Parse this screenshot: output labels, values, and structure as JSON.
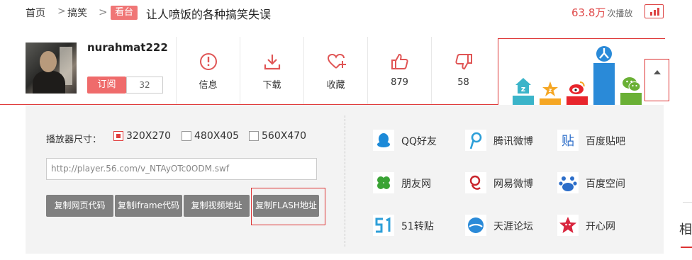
{
  "breadcrumb": {
    "home": "首页",
    "separator": ">",
    "category": "搞笑",
    "badge": "看台",
    "title": "让人喷饭的各种搞笑失误"
  },
  "plays": {
    "count": "63.8万",
    "label": "次播放"
  },
  "uploader": {
    "name": "nurahmat222",
    "subscribe_label": "订阅",
    "subscriber_count": "32"
  },
  "actions": [
    {
      "label": "信息",
      "icon": "info-icon"
    },
    {
      "label": "下载",
      "icon": "download-icon"
    },
    {
      "label": "收藏",
      "icon": "favorite-icon"
    },
    {
      "label": "879",
      "icon": "thumbs-up-icon"
    },
    {
      "label": "58",
      "icon": "thumbs-down-icon"
    }
  ],
  "embed": {
    "size_label": "播放器尺寸：",
    "sizes": [
      {
        "label": "320X270",
        "selected": true
      },
      {
        "label": "480X405",
        "selected": false
      },
      {
        "label": "560X470",
        "selected": false
      }
    ],
    "url": "http://player.56.com/v_NTAyOTc0ODM.swf",
    "buttons": [
      "复制网页代码",
      "复制iframe代码",
      "复制视频地址",
      "复制FLASH地址"
    ]
  },
  "share_sites": [
    {
      "name": "QQ好友",
      "icon": "qq-icon"
    },
    {
      "name": "腾讯微博",
      "icon": "tencent-weibo-icon"
    },
    {
      "name": "百度贴吧",
      "icon": "baidu-tieba-icon"
    },
    {
      "name": "朋友网",
      "icon": "pengyou-icon"
    },
    {
      "name": "网易微博",
      "icon": "netease-weibo-icon"
    },
    {
      "name": "百度空间",
      "icon": "baidu-space-icon"
    },
    {
      "name": "51转贴",
      "icon": "51-icon"
    },
    {
      "name": "天涯论坛",
      "icon": "tianya-icon"
    },
    {
      "name": "开心网",
      "icon": "kaixin-icon"
    }
  ],
  "right_fragment": "相",
  "colors": {
    "accent": "#e03c3c",
    "badge": "#f07676",
    "button_gray": "#808080",
    "panel_bg": "#f3f3f3"
  }
}
